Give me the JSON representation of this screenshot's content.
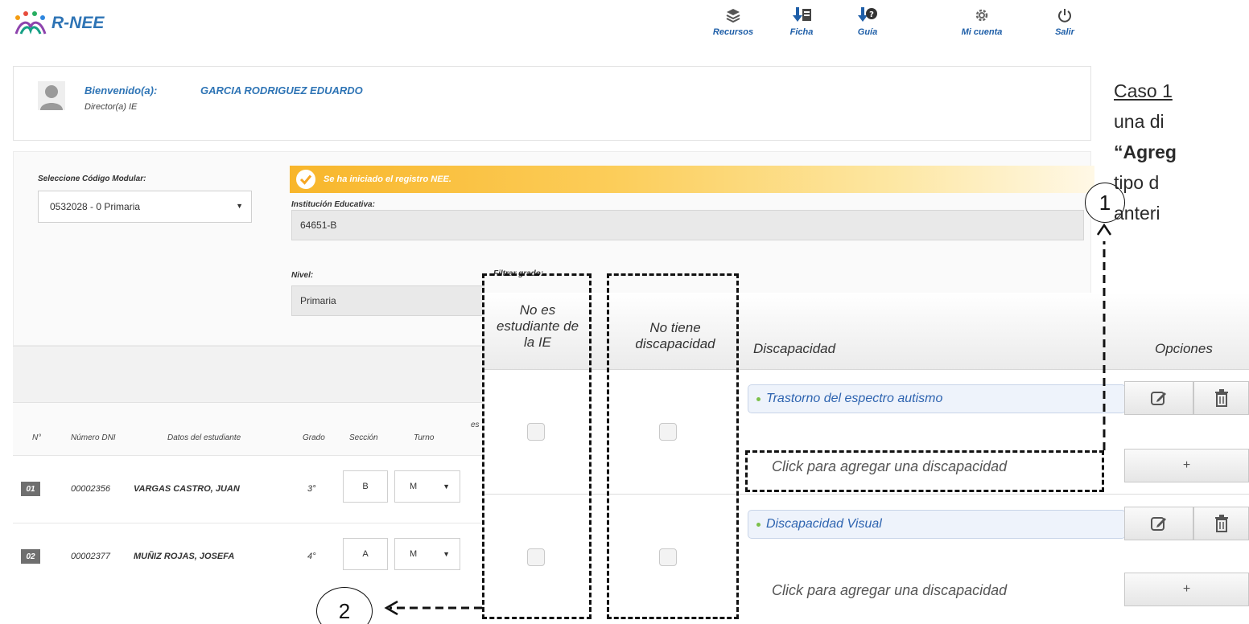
{
  "brand": {
    "name": "R-NEE"
  },
  "nav": [
    {
      "id": "recursos",
      "label": "Recursos",
      "icon": "layers-icon"
    },
    {
      "id": "ficha",
      "label": "Ficha",
      "icon": "download-pdf-icon"
    },
    {
      "id": "guia",
      "label": "Guía",
      "icon": "download-help-icon"
    },
    {
      "id": "micuenta",
      "label": "Mi cuenta",
      "icon": "gear-icon"
    },
    {
      "id": "salir",
      "label": "Salir",
      "icon": "power-icon"
    }
  ],
  "welcome": {
    "label": "Bienvenido(a):",
    "name": "GARCIA RODRIGUEZ EDUARDO",
    "role": "Director(a) IE"
  },
  "form": {
    "codigo_label": "Seleccione Código Modular:",
    "codigo_value": "0532028 - 0   Primaria",
    "banner": "Se ha iniciado el registro NEE.",
    "institucion_label": "Institución Educativa:",
    "institucion_value": "64651-B",
    "nivel_label": "Nivel:",
    "nivel_value": "Primaria",
    "filtrar_label": "Filtrar grado:"
  },
  "table": {
    "headers": [
      "N°",
      "Número DNI",
      "Datos del estudiante",
      "Grado",
      "Sección",
      "Turno",
      "es"
    ],
    "rows": [
      {
        "num": "01",
        "dni": "00002356",
        "nombre": "VARGAS CASTRO, JUAN",
        "grado": "3°",
        "seccion": "B",
        "turno": "M"
      },
      {
        "num": "02",
        "dni": "00002377",
        "nombre": "MUÑIZ ROJAS, JOSEFA",
        "grado": "4°",
        "seccion": "A",
        "turno": "M"
      }
    ]
  },
  "zoom": {
    "headers": {
      "no_es": "No es estudiante de la IE",
      "no_tiene": "No tiene discapacidad",
      "discapacidad": "Discapacidad",
      "opciones": "Opciones"
    },
    "rows": [
      {
        "discapacidad": "Trastorno del espectro autismo",
        "add_link": "Click para agregar una discapacidad",
        "add_btn": "+"
      },
      {
        "discapacidad": "Discapacidad Visual",
        "add_link": "Click para agregar una discapacidad",
        "add_btn": "+"
      }
    ]
  },
  "annotations": {
    "marker1": "1",
    "marker2": "2",
    "caso": {
      "line1": "Caso 1",
      "line2": "una di",
      "line3": "“Agreg",
      "line4": "tipo d",
      "line5": "anteri"
    }
  }
}
